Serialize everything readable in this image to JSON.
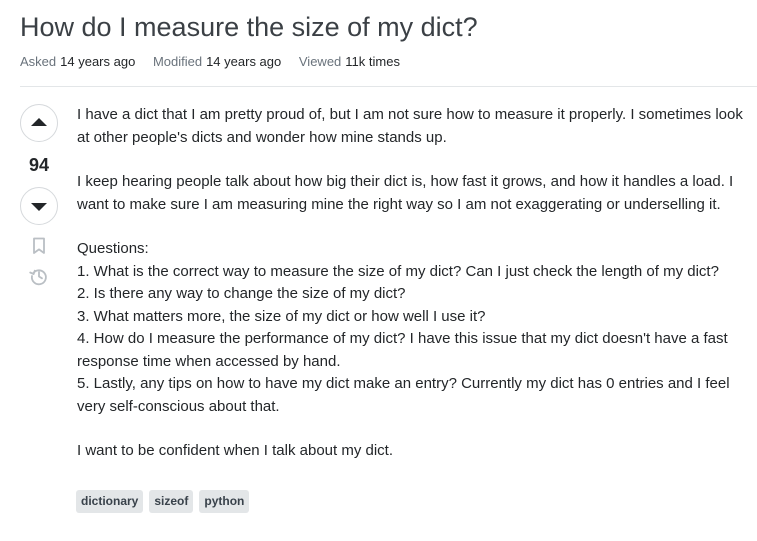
{
  "question": {
    "title": "How do I measure the size of my dict?",
    "meta": {
      "asked_label": "Asked",
      "asked_value": "14 years ago",
      "modified_label": "Modified",
      "modified_value": "14 years ago",
      "viewed_label": "Viewed",
      "viewed_value": "11k times"
    },
    "votes": "94",
    "body": {
      "p1": "I have a dict that I am pretty proud of, but I am not sure how to measure it properly. I sometimes look at other people's dicts and wonder how mine stands up.",
      "p2": "I keep hearing people talk about how big their dict is, how fast it grows, and how it handles a load. I want to make sure I am measuring mine the right way so I am not exaggerating or underselling it.",
      "questions_heading": "Questions:",
      "q1": "1. What is the correct way to measure the size of my dict? Can I just check the length of my dict?",
      "q2": "2. Is there any way to change the size of my dict?",
      "q3": "3. What matters more, the size of my dict or how well I use it?",
      "q4": "4. How do I measure the performance of my dict? I have this issue that my dict doesn't have a fast response time when accessed by hand.",
      "q5": "5. Lastly, any tips on how to have my dict make an entry? Currently my dict has 0 entries and I feel very self-conscious about that.",
      "closing": "I want to be confident when I talk about my dict."
    },
    "tags": [
      "dictionary",
      "sizeof",
      "python"
    ]
  },
  "icons": {
    "upvote": "upvote-arrow-icon",
    "downvote": "downvote-arrow-icon",
    "bookmark": "bookmark-icon",
    "history": "history-icon"
  },
  "colors": {
    "title": "#3b4045",
    "meta_label": "#6a737c",
    "tag_bg": "#e3e6e8",
    "tag_text": "#39424b",
    "vote_border": "#d6d9dc",
    "side_icon": "#babfc4"
  }
}
